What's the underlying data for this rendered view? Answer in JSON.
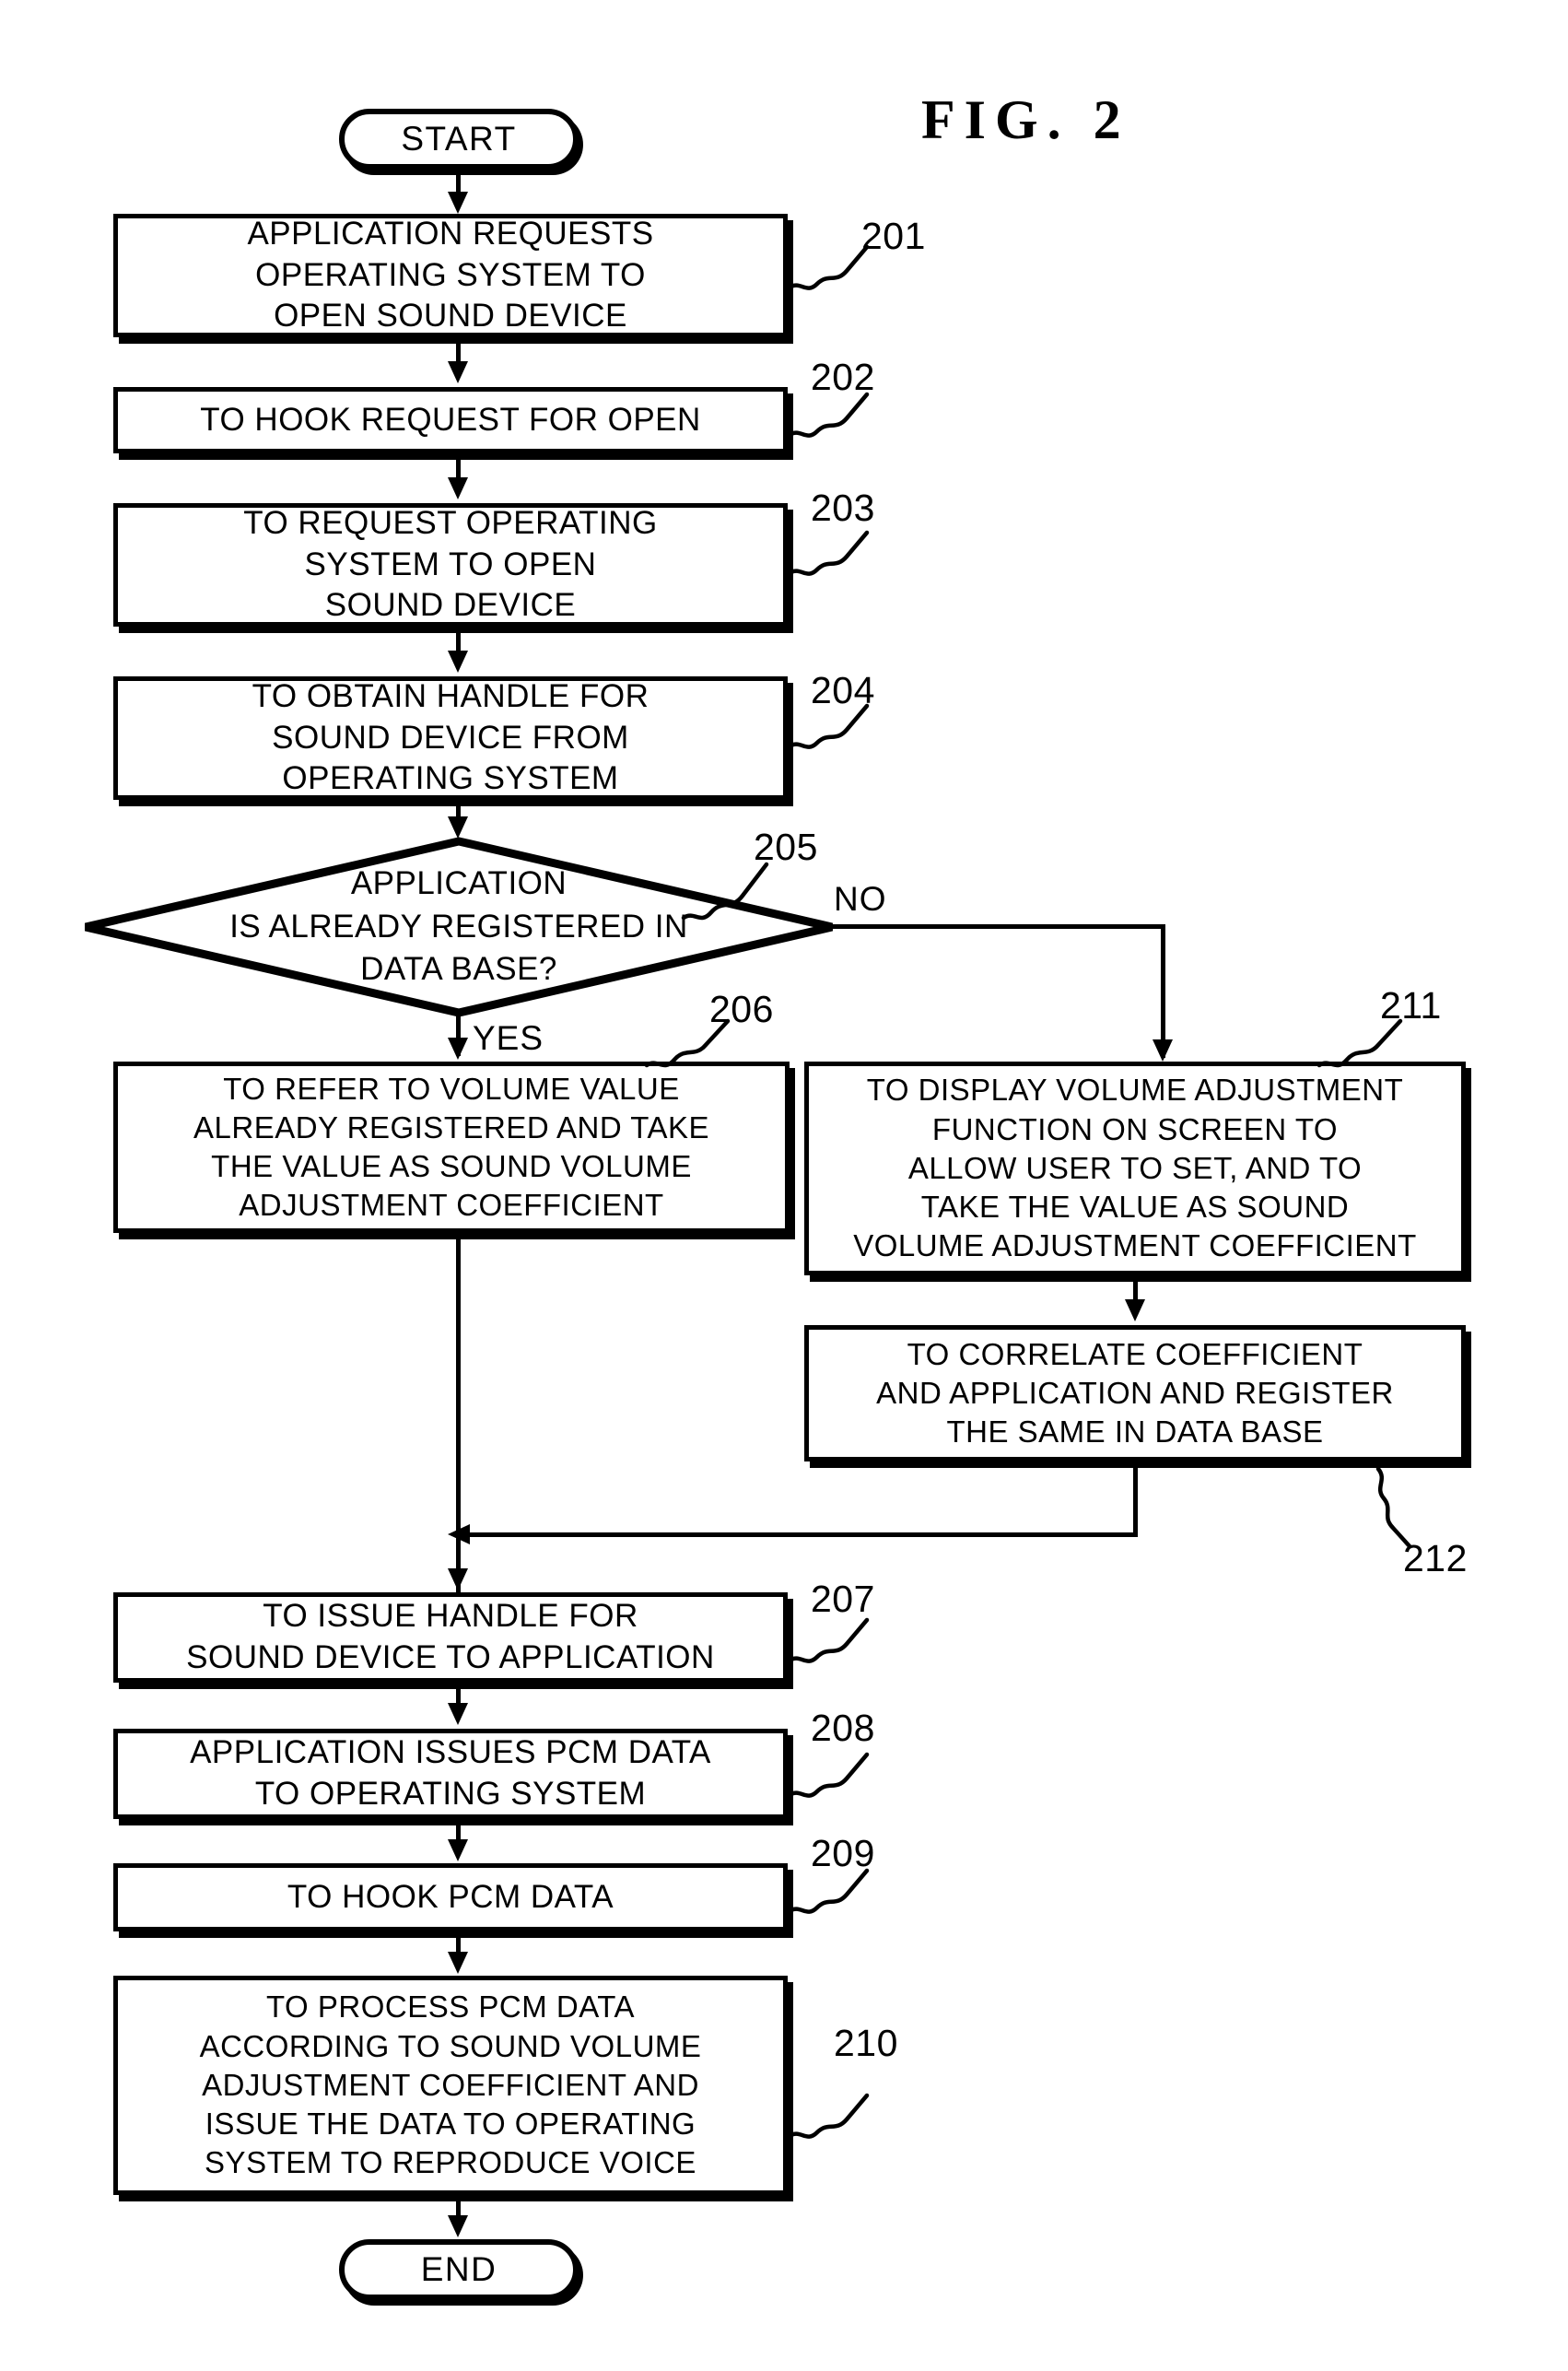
{
  "figure": {
    "title": "FIG. 2"
  },
  "terminals": {
    "start": "START",
    "end": "END"
  },
  "branch_labels": {
    "no": "NO",
    "yes": "YES"
  },
  "nodes": [
    {
      "ref": "201",
      "lines": [
        "APPLICATION REQUESTS",
        "OPERATING SYSTEM TO",
        "OPEN SOUND DEVICE"
      ]
    },
    {
      "ref": "202",
      "lines": [
        "TO HOOK REQUEST FOR OPEN"
      ]
    },
    {
      "ref": "203",
      "lines": [
        "TO REQUEST OPERATING",
        "SYSTEM TO OPEN",
        "SOUND DEVICE"
      ]
    },
    {
      "ref": "204",
      "lines": [
        "TO OBTAIN HANDLE FOR",
        "SOUND DEVICE FROM",
        "OPERATING SYSTEM"
      ]
    },
    {
      "ref": "205",
      "lines": [
        "APPLICATION",
        "IS ALREADY REGISTERED IN",
        "DATA BASE?"
      ]
    },
    {
      "ref": "206",
      "lines": [
        "TO REFER TO VOLUME VALUE",
        "ALREADY REGISTERED AND TAKE",
        "THE VALUE AS SOUND VOLUME",
        "ADJUSTMENT COEFFICIENT"
      ]
    },
    {
      "ref": "211",
      "lines": [
        "TO DISPLAY VOLUME ADJUSTMENT",
        "FUNCTION ON SCREEN TO",
        "ALLOW USER TO SET, AND TO",
        "TAKE THE VALUE AS SOUND",
        "VOLUME ADJUSTMENT COEFFICIENT"
      ]
    },
    {
      "ref": "212",
      "lines": [
        "TO CORRELATE COEFFICIENT",
        "AND APPLICATION AND REGISTER",
        "THE SAME IN DATA BASE"
      ]
    },
    {
      "ref": "207",
      "lines": [
        "TO ISSUE HANDLE FOR",
        "SOUND DEVICE TO APPLICATION"
      ]
    },
    {
      "ref": "208",
      "lines": [
        "APPLICATION ISSUES PCM DATA",
        "TO OPERATING SYSTEM"
      ]
    },
    {
      "ref": "209",
      "lines": [
        "TO HOOK PCM DATA"
      ]
    },
    {
      "ref": "210",
      "lines": [
        "TO PROCESS PCM DATA",
        "ACCORDING TO SOUND VOLUME",
        "ADJUSTMENT COEFFICIENT AND",
        "ISSUE THE DATA TO OPERATING",
        "SYSTEM TO REPRODUCE VOICE"
      ]
    }
  ],
  "colors": {
    "ink": "#000000",
    "paper": "#ffffff"
  }
}
